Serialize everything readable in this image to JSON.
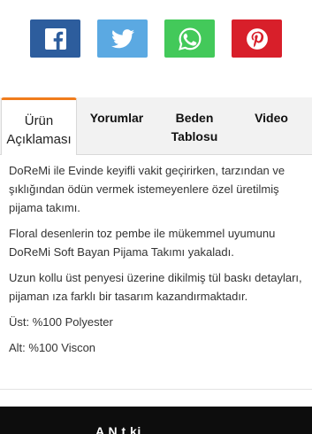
{
  "share": {
    "buttons": [
      {
        "icon": "facebook-icon",
        "color": "#2d5d9d"
      },
      {
        "icon": "twitter-icon",
        "color": "#5ba9e2"
      },
      {
        "icon": "whatsapp-icon",
        "color": "#43c95a"
      },
      {
        "icon": "pinterest-icon",
        "color": "#d81f2a"
      }
    ]
  },
  "tabs": {
    "description_line1": "Ürün",
    "description_line2": "Açıklaması",
    "comments": "Yorumlar",
    "size_line1": "Beden",
    "size_line2": "Tablosu",
    "video": "Video",
    "active_color": "#f07c1c"
  },
  "description": {
    "p1": "DoReMi ile Evinde keyifli vakit geçirirken, tarzından ve şıklığından ödün vermek istemeyenlere özel üretilmiş pijama takımı.",
    "p2": "Floral desenlerin toz pembe ile mükemmel uyumunu DoReMi Soft Bayan Pijama Takımı yakaladı.",
    "p3": "Uzun kollu üst penyesi üzerine dikilmiş tül baskı detayları, pijaman ıza farklı bir tasarım kazandırmaktadır.",
    "p4": "Üst: %100 Polyester",
    "p5": "Alt: %100 Viscon"
  },
  "footer": {
    "text": "A      N  t     ki"
  }
}
